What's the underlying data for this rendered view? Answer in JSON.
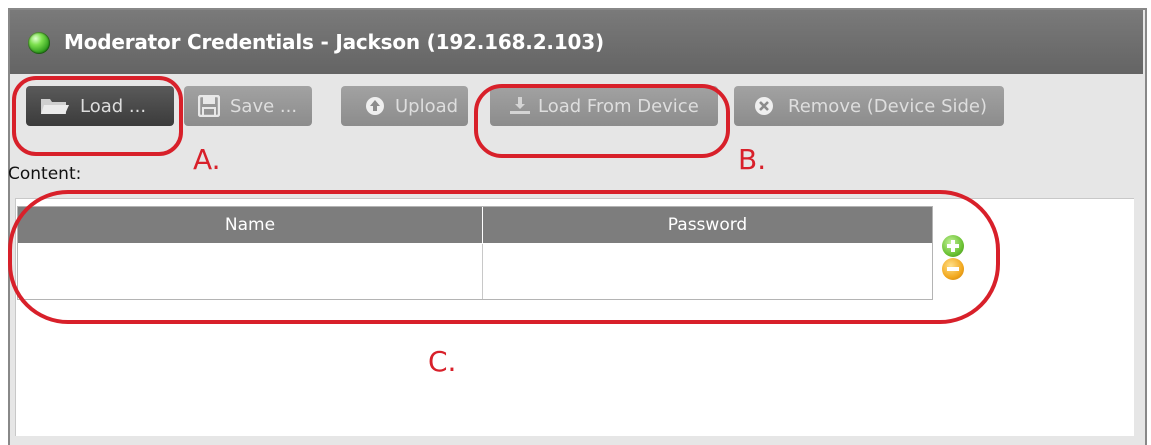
{
  "window": {
    "title": "Moderator Credentials - Jackson (192.168.2.103)",
    "status_icon": "green-led-icon"
  },
  "toolbar": {
    "load_label": "Load ...",
    "save_label": "Save ...",
    "upload_label": "Upload",
    "load_from_device_label": "Load From Device",
    "remove_label": "Remove (Device Side)"
  },
  "content": {
    "label": "Content:",
    "columns": [
      "Name",
      "Password"
    ],
    "rows": []
  },
  "annotations": {
    "a": "A.",
    "b": "B.",
    "c": "C."
  },
  "colors": {
    "titlebar": "#6e6e6e",
    "annotation": "#d8202a",
    "add_button": "#6cc234",
    "remove_button": "#f2a81e"
  }
}
